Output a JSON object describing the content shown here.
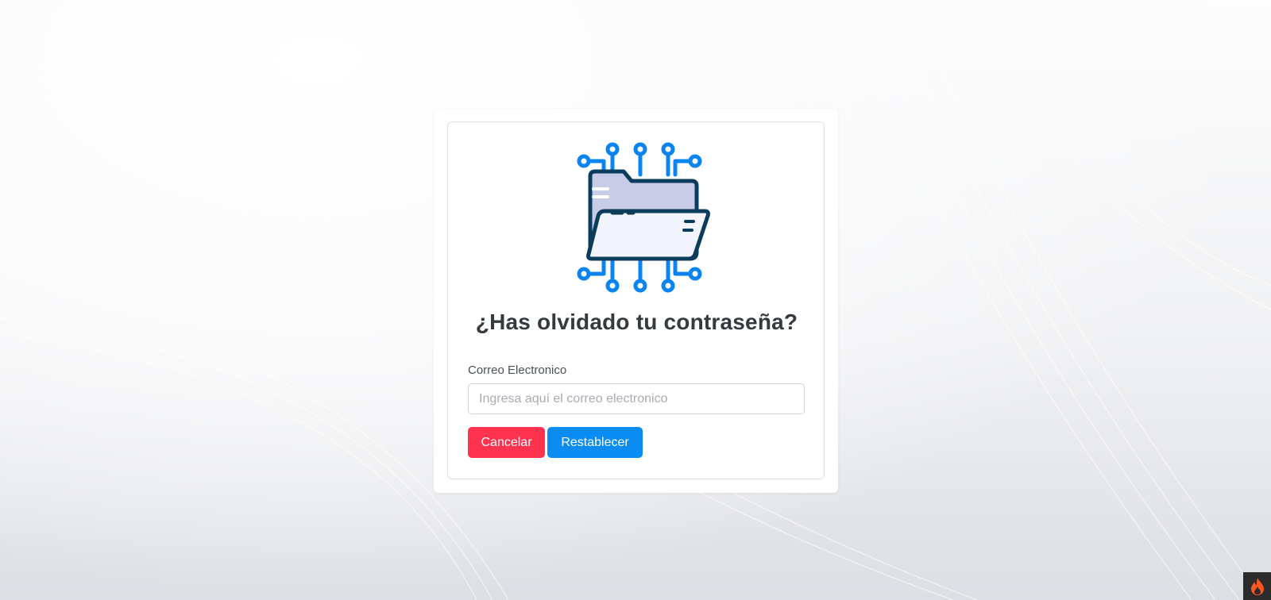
{
  "title": "¿Has olvidado tu contraseña?",
  "form": {
    "email_label": "Correo Electronico",
    "email_placeholder": "Ingresa aquí el correo electronico",
    "email_value": ""
  },
  "buttons": {
    "cancel_label": "Cancelar",
    "reset_label": "Restablecer"
  },
  "icons": {
    "illustration": "circuit-folder-icon",
    "corner": "flame-icon"
  },
  "colors": {
    "cancel": "#ff334f",
    "reset": "#0a8cf2",
    "title": "#343a40",
    "circuit": "#0a84f0",
    "folder_outline": "#0c3c5c"
  }
}
